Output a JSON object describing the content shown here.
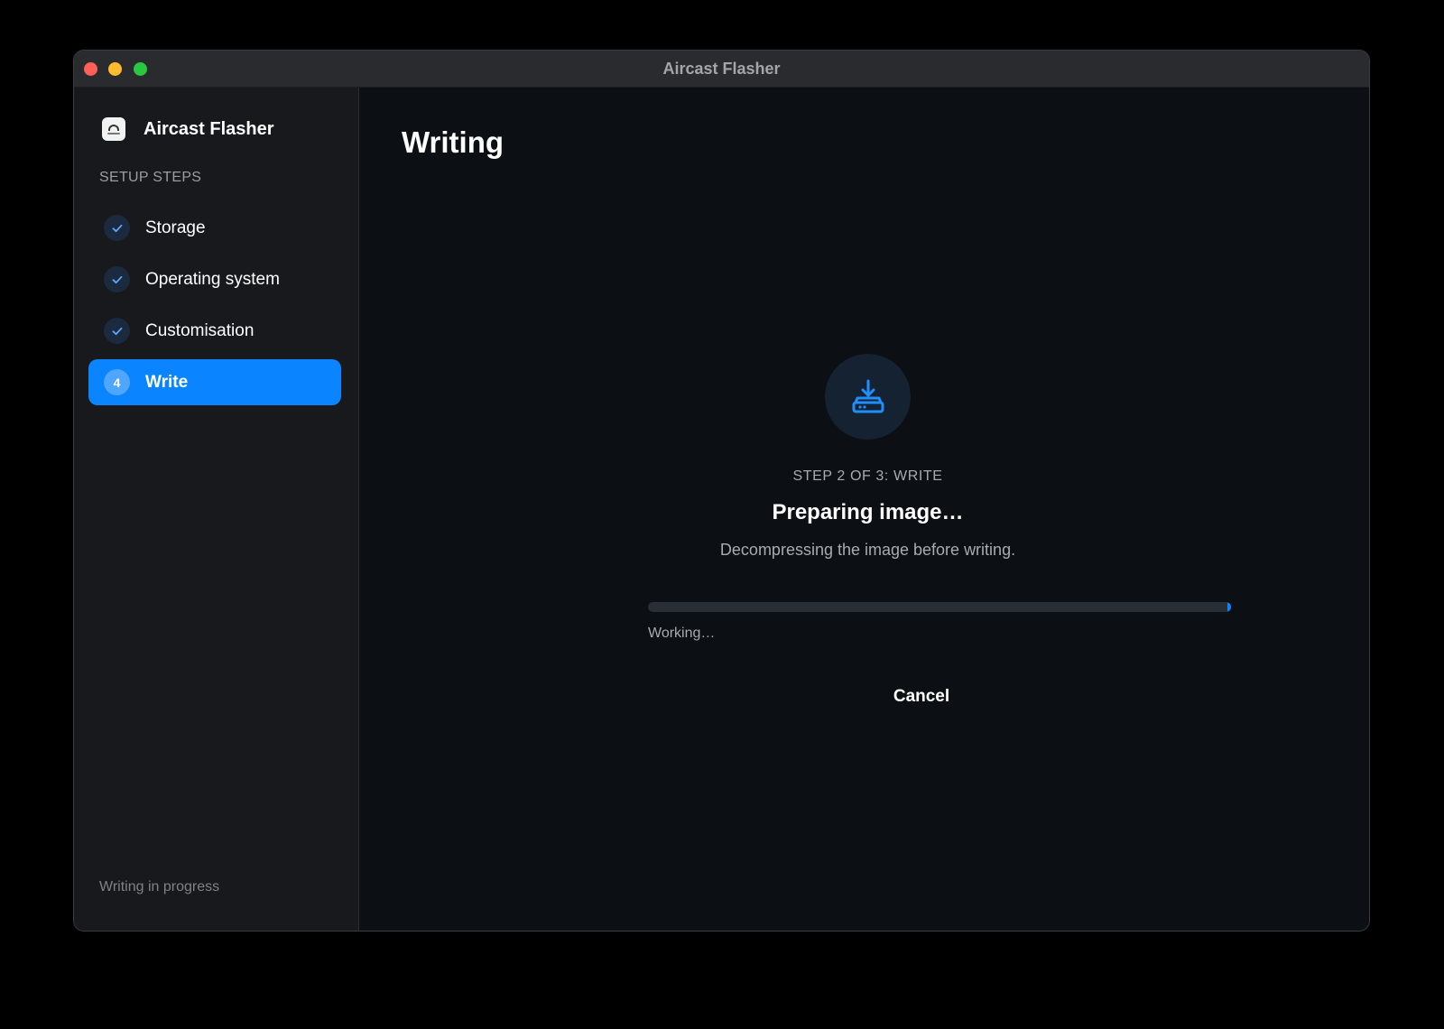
{
  "window": {
    "title": "Aircast Flasher"
  },
  "sidebar": {
    "app_name": "Aircast Flasher",
    "section_label": "SETUP STEPS",
    "steps": [
      {
        "label": "Storage",
        "state": "complete",
        "icon": "checkmark-icon"
      },
      {
        "label": "Operating system",
        "state": "complete",
        "icon": "checkmark-icon"
      },
      {
        "label": "Customisation",
        "state": "complete",
        "icon": "checkmark-icon"
      },
      {
        "label": "Write",
        "state": "active",
        "number": "4"
      }
    ],
    "footer": "Writing in progress"
  },
  "main": {
    "title": "Writing",
    "status_icon": "download-to-drive-icon",
    "step_caption": "STEP 2 OF 3: WRITE",
    "heading": "Preparing image…",
    "description": "Decompressing the image before writing.",
    "progress_label": "Working…",
    "cancel_label": "Cancel"
  },
  "colors": {
    "accent": "#0a84ff",
    "background": "#0c0f13",
    "sidebar": "#17191c",
    "close": "#fe5f57",
    "minimize": "#febc2e",
    "zoom": "#28c840"
  }
}
